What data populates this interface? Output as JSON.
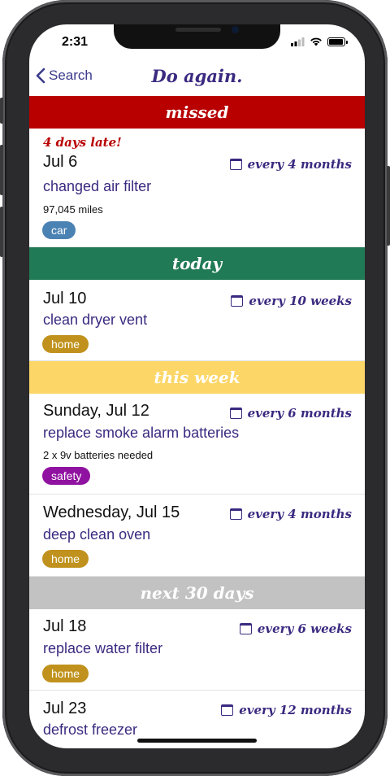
{
  "status_bar": {
    "time": "2:31"
  },
  "nav": {
    "back_label": "Search",
    "title": "Do again."
  },
  "sections": [
    {
      "label": "missed",
      "items": [
        {
          "late": "4 days late!",
          "date": "Jul 6",
          "frequency": "every 4 months",
          "task": "changed air filter",
          "note": "97,045 miles",
          "tag": "car"
        }
      ]
    },
    {
      "label": "today",
      "items": [
        {
          "date": "Jul 10",
          "frequency": "every 10 weeks",
          "task": "clean dryer vent",
          "tag": "home"
        }
      ]
    },
    {
      "label": "this week",
      "items": [
        {
          "date": "Sunday, Jul 12",
          "frequency": "every 6 months",
          "task": "replace smoke alarm batteries",
          "note": "2 x 9v batteries needed",
          "tag": "safety"
        },
        {
          "date": "Wednesday, Jul 15",
          "frequency": "every 4 months",
          "task": "deep clean oven",
          "tag": "home"
        }
      ]
    },
    {
      "label": "next 30 days",
      "items": [
        {
          "date": "Jul 18",
          "frequency": "every 6 weeks",
          "task": "replace water filter",
          "tag": "home"
        },
        {
          "date": "Jul 23",
          "frequency": "every 12 months",
          "task": "defrost freezer"
        }
      ]
    }
  ],
  "colors": {
    "missed": "#b80000",
    "today": "#217a56",
    "this_week": "#fcd667",
    "next_30_days": "#c2c2c2",
    "accent": "#3b2a80",
    "tag_car": "#4b82b4",
    "tag_home": "#c0921d",
    "tag_safety": "#8f12a0"
  },
  "icons": [
    "chevron-left-icon",
    "calendar-icon",
    "signal-icon",
    "wifi-icon",
    "battery-icon"
  ]
}
